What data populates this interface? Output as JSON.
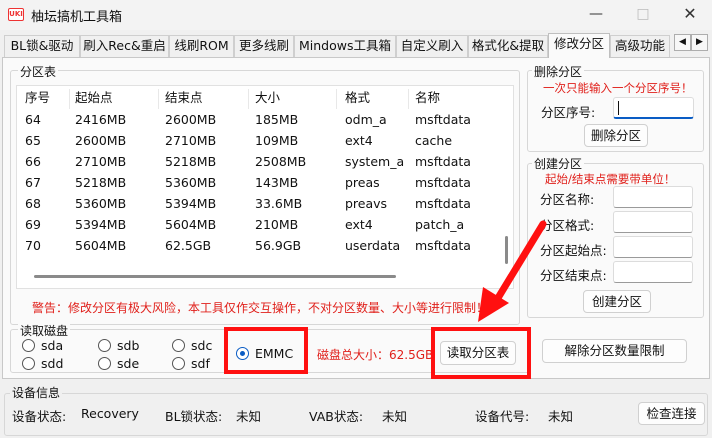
{
  "window": {
    "title": "柚坛搞机工具箱",
    "icon_text": "UKI"
  },
  "tabs": [
    "BL锁&驱动",
    "刷入Rec&重启",
    "线刷ROM",
    "更多线刷",
    "Mindows工具箱",
    "自定义刷入",
    "格式化&提取",
    "修改分区",
    "高级功能"
  ],
  "active_tab": "修改分区",
  "partition_table": {
    "group_label": "分区表",
    "columns": [
      "序号",
      "起始点",
      "结束点",
      "大小",
      "格式",
      "名称"
    ],
    "rows": [
      [
        "64",
        "2416MB",
        "2600MB",
        "185MB",
        "odm_a",
        "msftdata"
      ],
      [
        "65",
        "2600MB",
        "2710MB",
        "109MB",
        "ext4",
        "cache"
      ],
      [
        "66",
        "2710MB",
        "5218MB",
        "2508MB",
        "system_a",
        "msftdata"
      ],
      [
        "67",
        "5218MB",
        "5360MB",
        "143MB",
        "preas",
        "msftdata"
      ],
      [
        "68",
        "5360MB",
        "5394MB",
        "33.6MB",
        "preavs",
        "msftdata"
      ],
      [
        "69",
        "5394MB",
        "5604MB",
        "210MB",
        "ext4",
        "patch_a"
      ],
      [
        "70",
        "5604MB",
        "62.5GB",
        "56.9GB",
        "userdata",
        "msftdata"
      ]
    ],
    "warning": "警告：修改分区有极大风险，本工具仅作交互操作，不对分区数量、大小等进行限制！"
  },
  "delete_partition": {
    "group_label": "删除分区",
    "hint": "一次只能输入一个分区序号！",
    "number_label": "分区序号:",
    "number_value": "",
    "button": "删除分区"
  },
  "create_partition": {
    "group_label": "创建分区",
    "hint": "起始/结束点需要带单位！",
    "name_label": "分区名称:",
    "format_label": "分区格式:",
    "start_label": "分区起始点:",
    "end_label": "分区结束点:",
    "button": "创建分区"
  },
  "read_disk": {
    "group_label": "读取磁盘",
    "options": [
      "sda",
      "sdb",
      "sdc",
      "sdd",
      "sde",
      "sdf"
    ],
    "emmc_label": "EMMC",
    "selected": "EMMC",
    "total_size_label": "磁盘总大小：62.5GB",
    "read_button": "读取分区表",
    "unlimit_button": "解除分区数量限制"
  },
  "device_info": {
    "group_label": "设备信息",
    "status_label": "设备状态:",
    "status_value": "Recovery",
    "bl_label": "BL锁状态:",
    "bl_value": "未知",
    "vab_label": "VAB状态:",
    "vab_value": "未知",
    "code_label": "设备代号:",
    "code_value": "未知",
    "check_button": "检查连接"
  },
  "colors": {
    "warning_red": "#e0201b",
    "annotation_red": "#ff1010",
    "radio_blue": "#0a5cc4"
  }
}
